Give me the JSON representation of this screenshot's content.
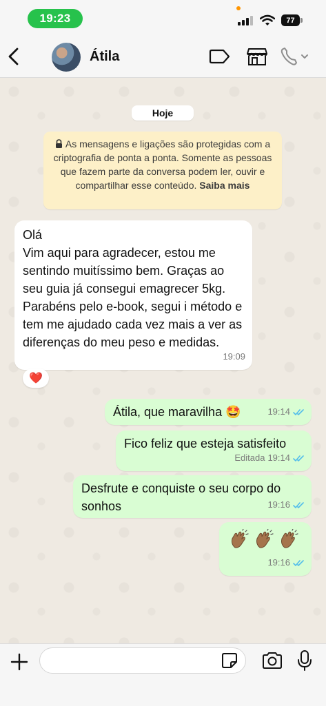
{
  "status_bar": {
    "time": "19:23",
    "battery": "77",
    "icons": [
      "signal-icon",
      "wifi-icon",
      "battery-icon"
    ]
  },
  "header": {
    "contact_name": "Átila",
    "icons": [
      "back-icon",
      "avatar",
      "label-icon",
      "store-icon",
      "call-icon",
      "chevron-down-icon"
    ]
  },
  "chat": {
    "day_chip": "Hoje",
    "encryption_notice": {
      "text": "As mensagens e ligações são protegidas com a criptografia de ponta a ponta. Somente as pessoas que fazem parte da conversa podem ler, ouvir e compartilhar esse conteúdo.",
      "link": "Saiba mais"
    },
    "messages": [
      {
        "direction": "in",
        "text": "Olá\nVim aqui para agradecer, estou me sentindo muitíssimo bem. Graças ao seu guia já consegui emagrecer 5kg. Parabéns pelo e-book, segui i método e tem me ajudado cada vez mais a ver as diferenças do meu peso e medidas.",
        "time": "19:09",
        "reaction": "❤️"
      },
      {
        "direction": "out",
        "text": "Átila, que maravilha 🤩",
        "time": "19:14",
        "read": true
      },
      {
        "direction": "out",
        "text": "Fico feliz que esteja satisfeito",
        "edited_label": "Editada",
        "time": "19:14",
        "read": true
      },
      {
        "direction": "out",
        "text": "Desfrute e conquiste o seu corpo do sonhos",
        "time": "19:16",
        "read": true
      },
      {
        "direction": "out",
        "text": "👏🏽👏🏽👏🏽",
        "time": "19:16",
        "read": true
      }
    ]
  },
  "composer": {
    "value": "",
    "icons": [
      "plus-icon",
      "sticker-icon",
      "camera-icon",
      "mic-icon"
    ]
  },
  "colors": {
    "status_pill": "#27c24c",
    "chat_background": "#efeae2",
    "incoming_bubble": "#ffffff",
    "outgoing_bubble": "#d9fdd3",
    "notice_background": "#fdf0c8",
    "read_ticks": "#53bdeb"
  }
}
